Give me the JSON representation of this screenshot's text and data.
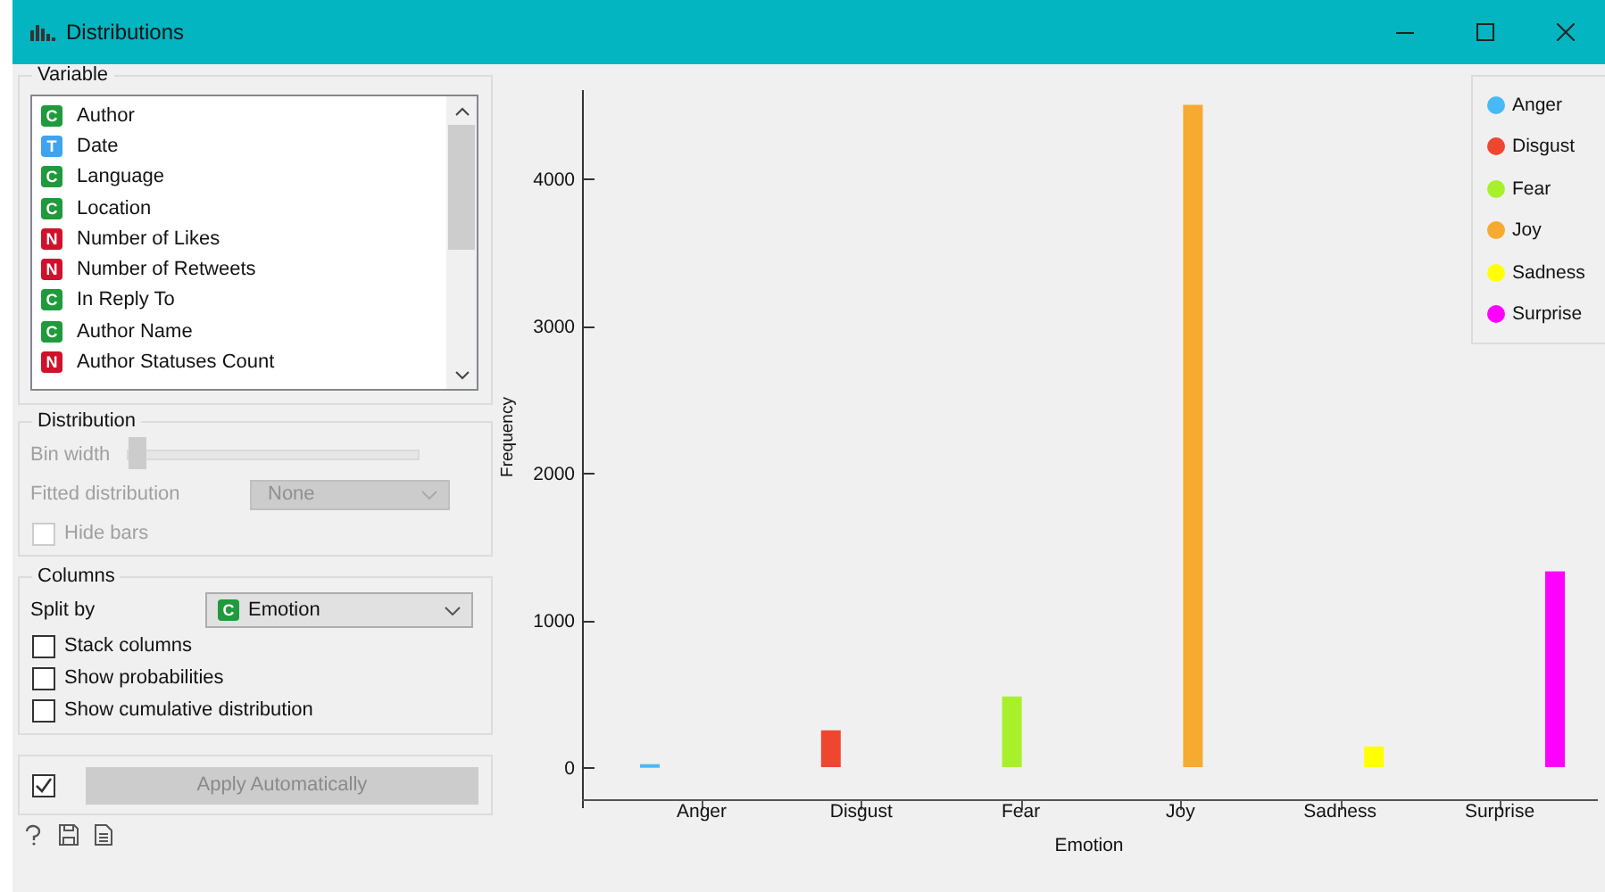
{
  "window": {
    "title": "Distributions"
  },
  "variable": {
    "title": "Variable",
    "items": [
      {
        "badge": "C",
        "color": "#1f9a3c",
        "name": "Author"
      },
      {
        "badge": "T",
        "color": "#3ea4f0",
        "name": "Date"
      },
      {
        "badge": "C",
        "color": "#1f9a3c",
        "name": "Language"
      },
      {
        "badge": "C",
        "color": "#1f9a3c",
        "name": "Location"
      },
      {
        "badge": "N",
        "color": "#d0112b",
        "name": "Number of Likes"
      },
      {
        "badge": "N",
        "color": "#d0112b",
        "name": "Number of Retweets"
      },
      {
        "badge": "C",
        "color": "#1f9a3c",
        "name": "In Reply To"
      },
      {
        "badge": "C",
        "color": "#1f9a3c",
        "name": "Author Name"
      },
      {
        "badge": "N",
        "color": "#d0112b",
        "name": "Author Statuses Count"
      }
    ]
  },
  "distribution": {
    "title": "Distribution",
    "bin_width": {
      "label": "Bin width",
      "level": 0,
      "disabled": true
    },
    "fitted": {
      "label": "Fitted distribution",
      "value": "None",
      "disabled": true
    },
    "hide_bars": {
      "label": "Hide bars",
      "checked": false,
      "disabled": true
    }
  },
  "columns": {
    "title": "Columns",
    "split_by": {
      "label": "Split by",
      "badge": "C",
      "color": "#1f9a3c",
      "value": "Emotion"
    },
    "options": [
      {
        "label": "Stack columns",
        "checked": false
      },
      {
        "label": "Show probabilities",
        "checked": false
      },
      {
        "label": "Show cumulative distribution",
        "checked": false
      }
    ]
  },
  "apply": {
    "checked": true,
    "button": {
      "label": "Apply Automatically",
      "disabled": true
    }
  },
  "chart_data": {
    "type": "bar",
    "xlabel": "Emotion",
    "ylabel": "Frequency",
    "categories": [
      "Anger",
      "Disgust",
      "Fear",
      "Joy",
      "Sadness",
      "Surprise"
    ],
    "series": [
      {
        "name": "Anger",
        "color": "#47b9f4",
        "values": [
          20,
          null,
          null,
          null,
          null,
          null
        ]
      },
      {
        "name": "Disgust",
        "color": "#ef4630",
        "values": [
          null,
          250,
          null,
          null,
          null,
          null
        ]
      },
      {
        "name": "Fear",
        "color": "#a8f02c",
        "values": [
          null,
          null,
          480,
          null,
          null,
          null
        ]
      },
      {
        "name": "Joy",
        "color": "#f6aa30",
        "values": [
          null,
          null,
          null,
          4500,
          null,
          null
        ]
      },
      {
        "name": "Sadness",
        "color": "#ffff00",
        "values": [
          null,
          null,
          null,
          null,
          140,
          null
        ]
      },
      {
        "name": "Surprise",
        "color": "#ff00ff",
        "values": [
          null,
          null,
          null,
          null,
          null,
          1330
        ]
      }
    ],
    "ylim": [
      0,
      4600
    ],
    "yticks": [
      0,
      1000,
      2000,
      3000,
      4000
    ]
  }
}
